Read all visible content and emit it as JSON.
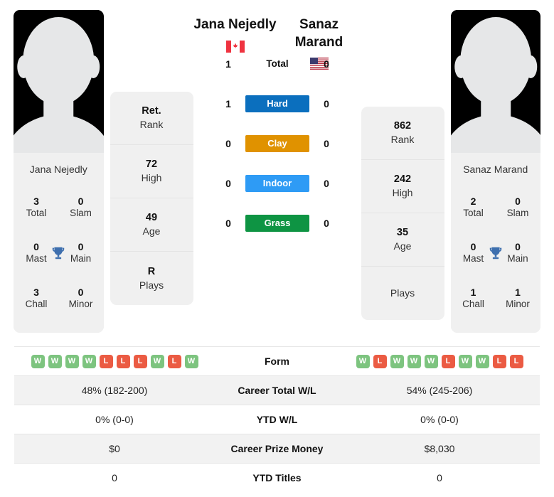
{
  "players": {
    "left": {
      "name": "Jana Nejedly",
      "card_name": "Jana Nejedly",
      "country": "Canada",
      "flag_icon": "flag-canada-icon",
      "rank": "Ret.",
      "rank_label": "Rank",
      "high": "72",
      "high_label": "High",
      "age": "49",
      "age_label": "Age",
      "plays": "R",
      "plays_label": "Plays",
      "titles": {
        "total": "3",
        "total_label": "Total",
        "slam": "0",
        "slam_label": "Slam",
        "mast": "0",
        "mast_label": "Mast",
        "main": "0",
        "main_label": "Main",
        "chall": "3",
        "chall_label": "Chall",
        "minor": "0",
        "minor_label": "Minor"
      },
      "h2h": {
        "total": "1",
        "hard": "1",
        "clay": "0",
        "indoor": "0",
        "grass": "0"
      },
      "form": [
        "W",
        "W",
        "W",
        "W",
        "L",
        "L",
        "L",
        "W",
        "L",
        "W"
      ],
      "career_total_wl": "48% (182-200)",
      "ytd_wl": "0% (0-0)",
      "career_prize_money": "$0",
      "ytd_titles": "0"
    },
    "right": {
      "name": "Sanaz Marand",
      "card_name": "Sanaz Marand",
      "country": "United States",
      "flag_icon": "flag-usa-icon",
      "rank": "862",
      "rank_label": "Rank",
      "high": "242",
      "high_label": "High",
      "age": "35",
      "age_label": "Age",
      "plays": "",
      "plays_label": "Plays",
      "titles": {
        "total": "2",
        "total_label": "Total",
        "slam": "0",
        "slam_label": "Slam",
        "mast": "0",
        "mast_label": "Mast",
        "main": "0",
        "main_label": "Main",
        "chall": "1",
        "chall_label": "Chall",
        "minor": "1",
        "minor_label": "Minor"
      },
      "h2h": {
        "total": "0",
        "hard": "0",
        "clay": "0",
        "indoor": "0",
        "grass": "0"
      },
      "form": [
        "W",
        "L",
        "W",
        "W",
        "W",
        "L",
        "W",
        "W",
        "L",
        "L"
      ],
      "career_total_wl": "54% (245-206)",
      "ytd_wl": "0% (0-0)",
      "career_prize_money": "$8,030",
      "ytd_titles": "0"
    }
  },
  "surfaces": [
    {
      "key": "total",
      "label": "Total",
      "color": "transparent",
      "text_color": "#111111"
    },
    {
      "key": "hard",
      "label": "Hard",
      "color": "#0b6fbe",
      "text_color": "#ffffff"
    },
    {
      "key": "clay",
      "label": "Clay",
      "color": "#e09200",
      "text_color": "#ffffff"
    },
    {
      "key": "indoor",
      "label": "Indoor",
      "color": "#2e9bf5",
      "text_color": "#ffffff"
    },
    {
      "key": "grass",
      "label": "Grass",
      "color": "#0e9443",
      "text_color": "#ffffff"
    }
  ],
  "table": {
    "rows": [
      {
        "label": "Form"
      },
      {
        "label": "Career Total W/L"
      },
      {
        "label": "YTD W/L"
      },
      {
        "label": "Career Prize Money"
      },
      {
        "label": "YTD Titles"
      }
    ]
  },
  "colors": {
    "win_badge": "#7dc47f",
    "loss_badge": "#eb5b43",
    "trophy": "#3e6fae",
    "panel_bg": "#f0f0f0",
    "row_shade": "#f2f2f2"
  }
}
